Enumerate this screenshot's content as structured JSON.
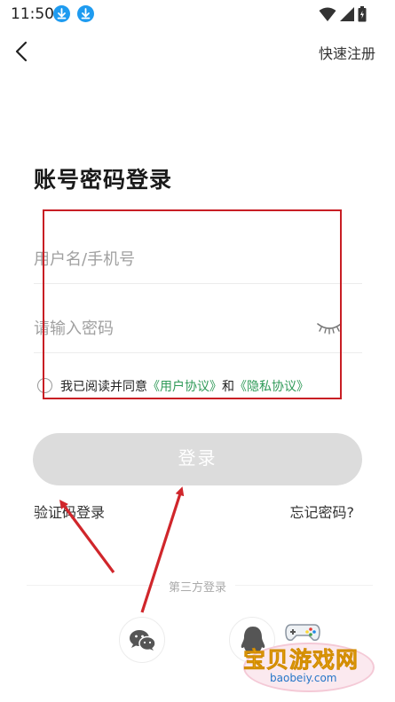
{
  "status_bar": {
    "time": "11:50",
    "icons": [
      "download-icon",
      "download-icon",
      "wifi-icon",
      "signal-icon",
      "battery-icon"
    ]
  },
  "header": {
    "back_icon": "chevron-left-icon",
    "quick_register": "快速注册"
  },
  "title": "账号密码登录",
  "form": {
    "username_placeholder": "用户名/手机号",
    "password_placeholder": "请输入密码",
    "agree_prefix": "我已阅读并同意",
    "user_agreement": "《用户协议》",
    "and": "和",
    "privacy_agreement": "《隐私协议》",
    "login_label": "登录"
  },
  "links": {
    "sms_login": "验证码登录",
    "forgot_password": "忘记密码?"
  },
  "third_party": {
    "label": "第三方登录",
    "providers": [
      "wechat-icon",
      "qq-icon"
    ]
  },
  "watermark": {
    "title": "宝贝游戏网",
    "url": "baobeiy.com"
  },
  "colors": {
    "accent_link": "#2f9a58",
    "login_disabled": "#dcdcdc",
    "annotation_red": "#c81e24",
    "download_blue": "#1e9bf0"
  }
}
